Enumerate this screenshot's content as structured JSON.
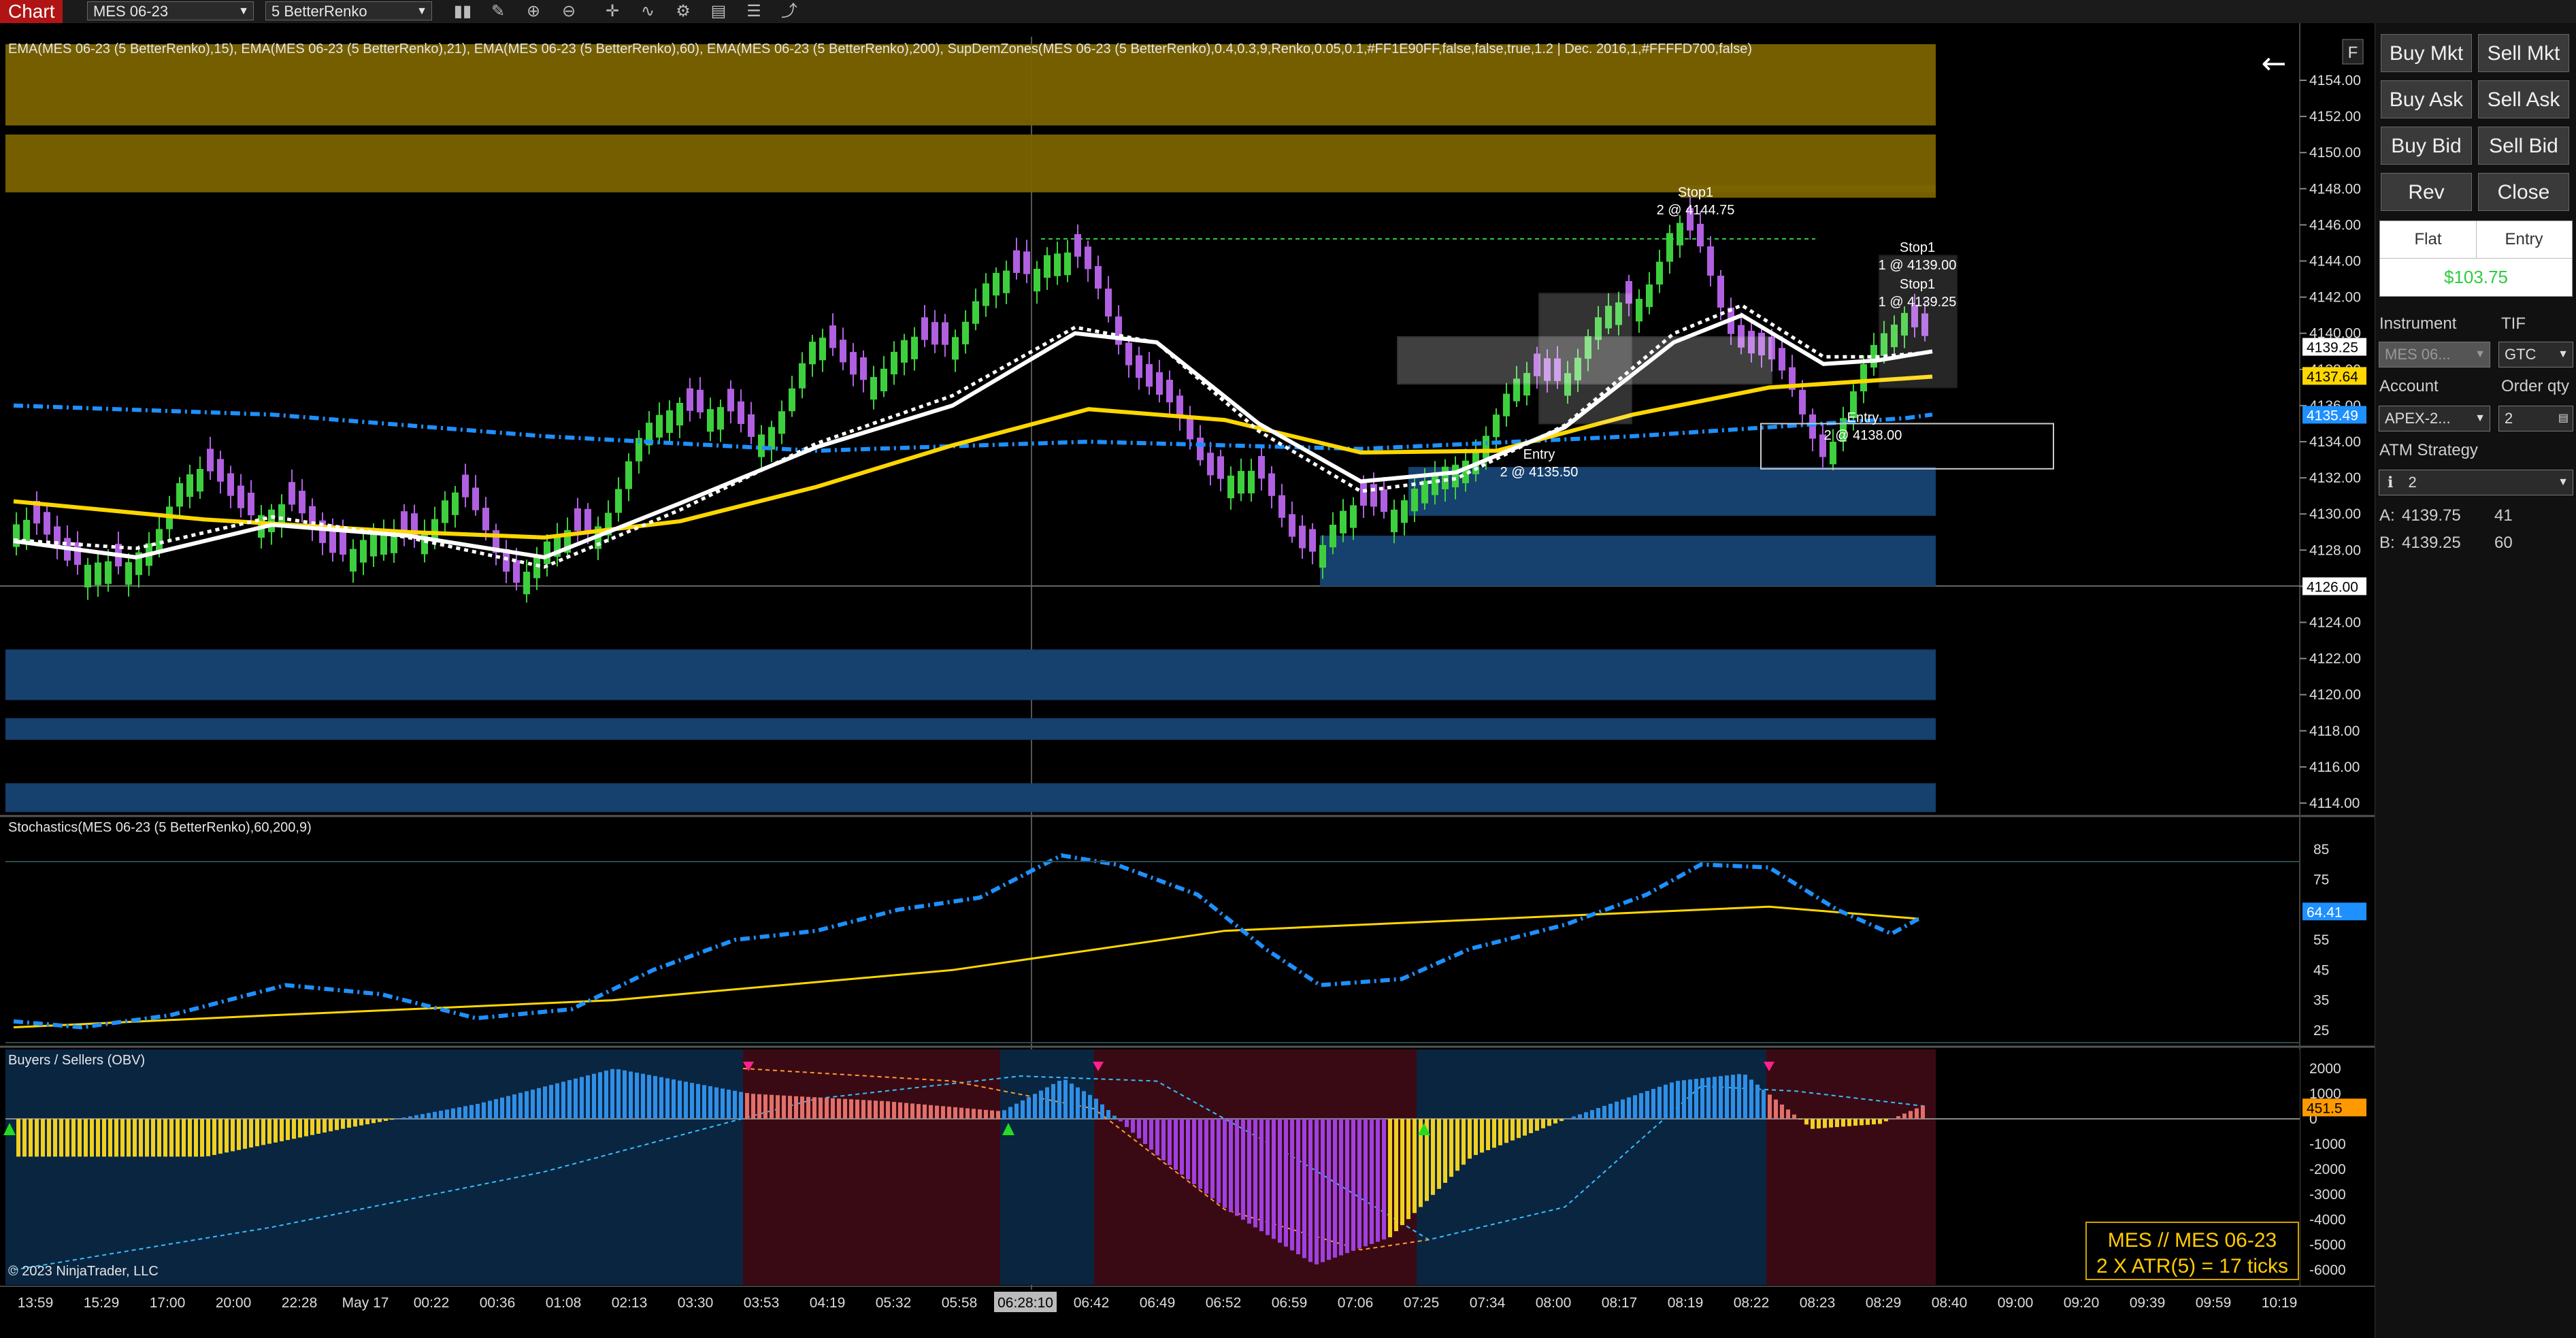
{
  "toolbar": {
    "title": "Chart",
    "instrument": "MES 06-23",
    "bar_type": "5 BetterRenko",
    "icons": [
      "bar-style-icon",
      "draw-icon",
      "zoom-in-icon",
      "zoom-out-icon",
      "crosshair-icon",
      "indicators-icon",
      "strategies-icon",
      "templates-icon",
      "properties-icon",
      "share-icon"
    ]
  },
  "panel_labels": {
    "price": "EMA(MES 06-23 (5 BetterRenko),15), EMA(MES 06-23 (5 BetterRenko),21), EMA(MES 06-23 (5 BetterRenko),60), EMA(MES 06-23 (5 BetterRenko),200), SupDemZones(MES 06-23 (5 BetterRenko),0.4,0.3,9,Renko,0.05,0.1,#FF1E90FF,false,false,true,1.2 | Dec. 2016,1,#FFFFD700,false)",
    "stoch": "Stochastics(MES 06-23 (5 BetterRenko),60,200,9)",
    "obv": "Buyers /  Sellers (OBV)",
    "copyright": "© 2023 NinjaTrader, LLC"
  },
  "price_axis": {
    "ticks": [
      "4154.00",
      "4152.00",
      "4150.00",
      "4148.00",
      "4146.00",
      "4144.00",
      "4142.00",
      "4140.00",
      "4138.00",
      "4136.00",
      "4134.00",
      "4132.00",
      "4130.00",
      "4128.00",
      "4126.00",
      "4124.00",
      "4122.00",
      "4120.00",
      "4118.00",
      "4116.00",
      "4114.00"
    ],
    "markers": [
      {
        "text": "4139.25",
        "price": 4139.25,
        "bg": "#ffffff",
        "fg": "#000000"
      },
      {
        "text": "4137.64",
        "price": 4137.64,
        "bg": "#ffd700",
        "fg": "#000000"
      },
      {
        "text": "4135.49",
        "price": 4135.49,
        "bg": "#1e90ff",
        "fg": "#ffffff"
      },
      {
        "text": "4126.00",
        "price": 4126.0,
        "bg": "#ffffff",
        "fg": "#000000"
      }
    ]
  },
  "stoch_axis": {
    "ticks": [
      "85",
      "75",
      "65",
      "55",
      "45",
      "35",
      "25"
    ],
    "marker": {
      "text": "64.41",
      "value": 64.41,
      "bg": "#1e90ff",
      "fg": "#ffffff"
    }
  },
  "obv_axis": {
    "ticks": [
      "2000",
      "1000",
      "0",
      "-1000",
      "-2000",
      "-3000",
      "-4000",
      "-5000",
      "-6000"
    ],
    "marker": {
      "text": "451.5",
      "value": 451.5,
      "bg": "#ff9900",
      "fg": "#000000"
    }
  },
  "time_axis": {
    "labels": [
      "13:59",
      "15:29",
      "17:00",
      "20:00",
      "22:28",
      "May 17",
      "00:22",
      "00:36",
      "01:08",
      "02:13",
      "03:30",
      "03:53",
      "04:19",
      "05:32",
      "05:58",
      "06:28:10",
      "06:42",
      "06:49",
      "06:52",
      "06:59",
      "07:06",
      "07:25",
      "07:34",
      "08:00",
      "08:17",
      "08:19",
      "08:22",
      "08:23",
      "08:29",
      "08:40",
      "09:00",
      "09:20",
      "09:39",
      "09:59",
      "10:19"
    ],
    "highlight": "06:28:10"
  },
  "orders": [
    {
      "name": "stop1-top",
      "label": "Stop1",
      "detail": "2 @ 4144.75"
    },
    {
      "name": "stop1-a",
      "label": "Stop1",
      "detail": "1 @ 4139.00"
    },
    {
      "name": "stop1-b",
      "label": "Stop1",
      "detail": "1 @ 4139.25"
    },
    {
      "name": "entry-a",
      "label": "Entry",
      "detail": "2 @ 4135.50"
    },
    {
      "name": "entry-b",
      "label": "Entry",
      "detail": "2 @ 4138.00"
    }
  ],
  "info_box": {
    "line1": "MES // MES 06-23",
    "line2": "2 X ATR(5) = 17 ticks"
  },
  "right_panel": {
    "buttons": [
      {
        "name": "buy-market-button",
        "label": "Buy Mkt"
      },
      {
        "name": "sell-market-button",
        "label": "Sell Mkt"
      },
      {
        "name": "buy-ask-button",
        "label": "Buy Ask"
      },
      {
        "name": "sell-ask-button",
        "label": "Sell Ask"
      },
      {
        "name": "buy-bid-button",
        "label": "Buy Bid"
      },
      {
        "name": "sell-bid-button",
        "label": "Sell Bid"
      },
      {
        "name": "reverse-button",
        "label": "Rev"
      },
      {
        "name": "close-button",
        "label": "Close"
      }
    ],
    "position_status": "Flat",
    "entry_label": "Entry",
    "pnl": "$103.75",
    "instrument_label": "Instrument",
    "instrument_value": "MES 06...",
    "tif_label": "TIF",
    "tif_value": "GTC",
    "account_label": "Account",
    "account_value": "APEX-2...",
    "order_qty_label": "Order qty",
    "order_qty_value": "2",
    "atm_label": "ATM Strategy",
    "atm_value": "2",
    "ask_label": "A:",
    "ask_price": "4139.75",
    "ask_size": "41",
    "bid_label": "B:",
    "bid_price": "4139.25",
    "bid_size": "60"
  },
  "colors": {
    "up": "#3ecf3e",
    "down": "#b060e0",
    "ema15": "#ffffff",
    "ema21": "#ffffff",
    "ema60": "#ffd700",
    "ema200": "#1e90ff",
    "supply": "#7a6300",
    "demand": "#16406e",
    "stoch_k": "#1e90ff",
    "stoch_d": "#ffd700",
    "obv_blue": "#2f8fe6",
    "obv_red": "#e0706a",
    "obv_yellow": "#f0d020",
    "obv_purple": "#a040e0",
    "bg_red": "#3a0a14",
    "bg_blue": "#0a2540"
  }
}
